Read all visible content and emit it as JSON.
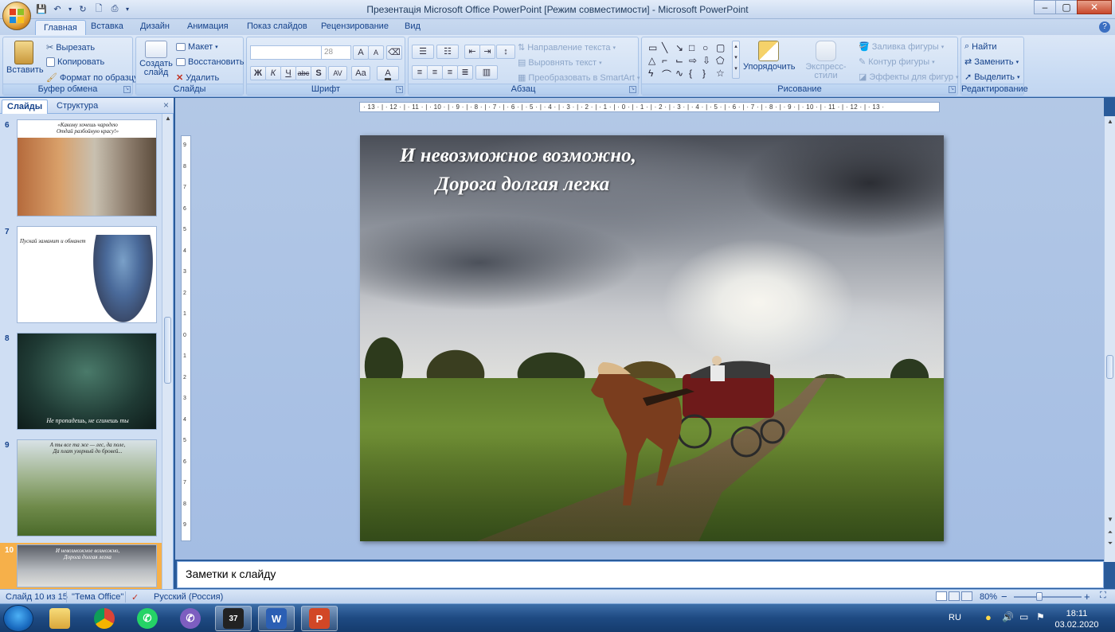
{
  "window": {
    "title": "Презентація Microsoft Office PowerPoint [Режим совместимости] - Microsoft PowerPoint",
    "minimize": "–",
    "maximize": "▢",
    "close": "✕"
  },
  "tabs": [
    "Главная",
    "Вставка",
    "Дизайн",
    "Анимация",
    "Показ слайдов",
    "Рецензирование",
    "Вид"
  ],
  "ribbon": {
    "clipboard": {
      "label": "Буфер обмена",
      "paste": "Вставить",
      "cut": "Вырезать",
      "copy": "Копировать",
      "format_painter": "Формат по образцу"
    },
    "slides": {
      "label": "Слайды",
      "new_slide_line1": "Создать",
      "new_slide_line2": "слайд",
      "layout": "Макет",
      "reset": "Восстановить",
      "delete": "Удалить"
    },
    "font": {
      "label": "Шрифт",
      "font_name": "",
      "font_size": "28",
      "bold": "Ж",
      "italic": "К",
      "underline": "Ч",
      "strike": "abc",
      "shadow": "S",
      "spacing": "AV",
      "case": "Aa",
      "grow": "A",
      "shrink": "A"
    },
    "paragraph": {
      "label": "Абзац",
      "text_direction": "Направление текста",
      "align_text": "Выровнять текст",
      "smartart": "Преобразовать в SmartArt"
    },
    "drawing": {
      "label": "Рисование",
      "arrange": "Упорядочить",
      "quick_styles": "Экспресс-стили",
      "shape_fill": "Заливка фигуры",
      "shape_outline": "Контур фигуры",
      "shape_effects": "Эффекты для фигур"
    },
    "editing": {
      "label": "Редактирование",
      "find": "Найти",
      "replace": "Заменить",
      "select": "Выделить"
    }
  },
  "left_panel": {
    "tab_slides": "Слайды",
    "tab_outline": "Структура",
    "close": "×",
    "thumbnails": [
      {
        "num": "6",
        "caption": "«Какому хочешь чародею\nОтдай разбойную красу!»"
      },
      {
        "num": "7",
        "caption": "Пускай заманит и обманет"
      },
      {
        "num": "8",
        "caption": "Не пропадешь, не сгинешь ты"
      },
      {
        "num": "9",
        "caption": "А ты все та же — лес, да поле,\nДа плат узорный до бровей..."
      },
      {
        "num": "10",
        "caption": "И невозможное возможно,\nДорога долгая легка"
      }
    ]
  },
  "ruler": {
    "horizontal": "· 13 · | · 12 · | · 11 · | · 10 · | · 9 · | · 8 · | · 7 · | · 6 · | · 5 · | · 4 · | · 3 · | · 2 · | · 1 · | · 0 · | · 1 · | · 2 · | · 3 · | · 4 · | · 5 · | · 6 · | · 7 · | · 8 · | · 9 · | · 10 · | · 11 · | · 12 · | · 13 ·",
    "vertical": [
      "9",
      "8",
      "7",
      "6",
      "5",
      "4",
      "3",
      "2",
      "1",
      "0",
      "1",
      "2",
      "3",
      "4",
      "5",
      "6",
      "7",
      "8",
      "9"
    ]
  },
  "slide": {
    "line1": "И невозможное возможно,",
    "line2": "Дорога долгая легка"
  },
  "notes": {
    "placeholder": "Заметки к слайду"
  },
  "status": {
    "slide_pos": "Слайд 10 из 15",
    "theme": "\"Тема Office\"",
    "language": "Русский (Россия)",
    "zoom": "80%",
    "zoom_out": "−",
    "zoom_in": "+"
  },
  "taskbar": {
    "language": "RU",
    "time": "18:11",
    "date": "03.02.2020",
    "apps": [
      "Проводник",
      "Google Chrome",
      "WhatsApp",
      "Viber",
      "Видео",
      "Word",
      "PowerPoint"
    ],
    "badge": "37"
  }
}
